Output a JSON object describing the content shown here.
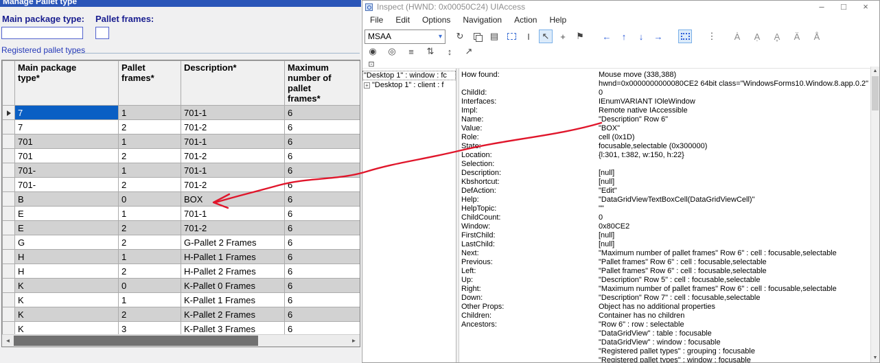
{
  "colors": {
    "selection_blue": "#0a5fc4",
    "alt_row_gray": "#d2d2d2",
    "label_navy": "#181d8f",
    "titlebar_blue": "#2a55b8",
    "annotation_red": "#e0162b"
  },
  "icons": {
    "minimize": "–",
    "maximize": "□",
    "close": "×",
    "combo_arrow": "▾",
    "refresh": "↻",
    "properties": "▤",
    "ibeam": "I",
    "pointer": "↖",
    "crosshair": "+",
    "flag": "⚑",
    "nav_left": "←",
    "nav_up": "↑",
    "nav_down": "↓",
    "nav_right": "→",
    "dots": "⋮",
    "a11y": [
      "Ȧ",
      "Ạ",
      "Ḁ",
      "Ä",
      "Å"
    ],
    "watch_cursor": "◉",
    "watch_focus": "◎",
    "list": "≡",
    "sort": "⇅",
    "updown": "↕",
    "export": "↗",
    "default_action": "⊡",
    "scroll_left": "◄",
    "scroll_right": "►",
    "scroll_up": "▲",
    "scroll_down": "▼",
    "tree_expander": "+"
  },
  "left_window": {
    "title": "Manage Pallet type",
    "labels": {
      "main_package_type": "Main package type:",
      "pallet_frames": "Pallet frames:",
      "group": "Registered pallet types"
    },
    "inputs": {
      "main_package_type": "",
      "pallet_frames": ""
    },
    "grid": {
      "columns": [
        "Main package type*",
        "Pallet frames*",
        "Description*",
        "Maximum number of pallet frames*"
      ],
      "selected_row_index": 0,
      "rows": [
        [
          "7",
          "1",
          "701-1",
          "6"
        ],
        [
          "7",
          "2",
          "701-2",
          "6"
        ],
        [
          "701",
          "1",
          "701-1",
          "6"
        ],
        [
          "701",
          "2",
          "701-2",
          "6"
        ],
        [
          "701-",
          "1",
          "701-1",
          "6"
        ],
        [
          "701-",
          "2",
          "701-2",
          "6"
        ],
        [
          "B",
          "0",
          "BOX",
          "6"
        ],
        [
          "E",
          "1",
          "701-1",
          "6"
        ],
        [
          "E",
          "2",
          "701-2",
          "6"
        ],
        [
          "G",
          "2",
          "G-Pallet 2 Frames",
          "6"
        ],
        [
          "H",
          "1",
          "H-Pallet 1 Frames",
          "6"
        ],
        [
          "H",
          "2",
          "H-Pallet 2 Frames",
          "6"
        ],
        [
          "K",
          "0",
          "K-Pallet 0 Frames",
          "6"
        ],
        [
          "K",
          "1",
          "K-Pallet 1 Frames",
          "6"
        ],
        [
          "K",
          "2",
          "K-Pallet 2 Frames",
          "6"
        ],
        [
          "K",
          "3",
          "K-Pallet 3 Frames",
          "6"
        ]
      ]
    }
  },
  "inspect": {
    "title": "Inspect  (HWND: 0x00050C24) UIAccess",
    "menu": [
      "File",
      "Edit",
      "Options",
      "Navigation",
      "Action",
      "Help"
    ],
    "toolbar": {
      "mode": "MSAA",
      "icon_names": [
        "refresh",
        "copy",
        "properties",
        "selection-rectangle",
        "text-cursor",
        "pointer",
        "crosshair",
        "flag",
        "nav-left",
        "nav-up",
        "nav-down",
        "nav-right",
        "highlight-toggle",
        "options-dots",
        "accessibility-checks",
        "watch-cursor",
        "watch-focus",
        "list-view",
        "sort",
        "up-down",
        "export",
        "default-action"
      ]
    },
    "tree": {
      "items": [
        "\"Desktop 1\" : window : fc",
        "\"Desktop 1\" : client : f"
      ]
    },
    "properties": [
      {
        "n": "How found:",
        "v": "Mouse move (338,388)"
      },
      {
        "n": "",
        "v": "hwnd=0x0000000000080CE2 64bit class=\"WindowsForms10.Window.8.app.0.2\""
      },
      {
        "n": "ChildId:",
        "v": "0"
      },
      {
        "n": "Interfaces:",
        "v": "IEnumVARIANT IOleWindow"
      },
      {
        "n": "Impl:",
        "v": "Remote native IAccessible"
      },
      {
        "n": "Name:",
        "v": "\"Description\" Row 6\""
      },
      {
        "n": "Value:",
        "v": "\"BOX\""
      },
      {
        "n": "Role:",
        "v": "cell (0x1D)"
      },
      {
        "n": "State:",
        "v": "focusable,selectable (0x300000)"
      },
      {
        "n": "Location:",
        "v": "{l:301, t:382, w:150, h:22}"
      },
      {
        "n": "Selection:",
        "v": ""
      },
      {
        "n": "Description:",
        "v": "[null]"
      },
      {
        "n": "Kbshortcut:",
        "v": "[null]"
      },
      {
        "n": "DefAction:",
        "v": "\"Edit\""
      },
      {
        "n": "Help:",
        "v": "\"DataGridViewTextBoxCell(DataGridViewCell)\""
      },
      {
        "n": "HelpTopic:",
        "v": "\"\""
      },
      {
        "n": "ChildCount:",
        "v": "0"
      },
      {
        "n": "Window:",
        "v": "0x80CE2"
      },
      {
        "n": "FirstChild:",
        "v": "[null]"
      },
      {
        "n": "LastChild:",
        "v": "[null]"
      },
      {
        "n": "Next:",
        "v": "\"Maximum number of pallet frames\" Row 6\" : cell : focusable,selectable"
      },
      {
        "n": "Previous:",
        "v": "\"Pallet frames\" Row 6\" : cell : focusable,selectable"
      },
      {
        "n": "Left:",
        "v": "\"Pallet frames\" Row 6\" : cell : focusable,selectable"
      },
      {
        "n": "Up:",
        "v": "\"Description\" Row 5\" : cell : focusable,selectable"
      },
      {
        "n": "Right:",
        "v": "\"Maximum number of pallet frames\" Row 6\" : cell : focusable,selectable"
      },
      {
        "n": "Down:",
        "v": "\"Description\" Row 7\" : cell : focusable,selectable"
      },
      {
        "n": "Other Props:",
        "v": "Object has no additional properties"
      },
      {
        "n": "Children:",
        "v": "Container has no children"
      },
      {
        "n": "Ancestors:",
        "v": "\"Row 6\" : row : selectable"
      },
      {
        "n": "",
        "v": "\"DataGridView\" : table : focusable"
      },
      {
        "n": "",
        "v": "\"DataGridView\" : window : focusable"
      },
      {
        "n": "",
        "v": "\"Registered pallet types\" : grouping : focusable"
      },
      {
        "n": "",
        "v": "\"Registered pallet types\" : window : focusable"
      }
    ]
  }
}
